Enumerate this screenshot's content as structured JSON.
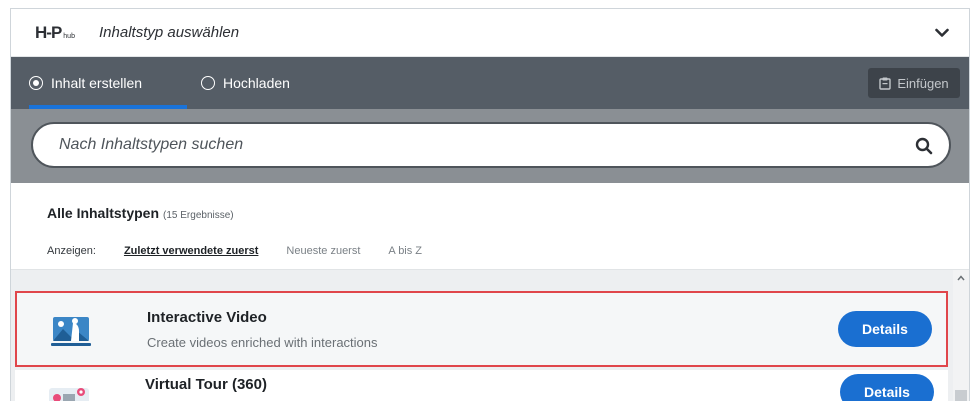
{
  "header": {
    "logo_main": "H-P",
    "logo_sub": "hub",
    "title": "Inhaltstyp auswählen",
    "collapse_icon": "chevron-down-icon"
  },
  "tabs": [
    {
      "label": "Inhalt erstellen",
      "selected": true
    },
    {
      "label": "Hochladen",
      "selected": false
    }
  ],
  "paste_button": {
    "label": "Einfügen",
    "icon": "clipboard-icon"
  },
  "search": {
    "placeholder": "Nach Inhaltstypen suchen",
    "value": "",
    "icon": "search-icon"
  },
  "results": {
    "heading": "Alle Inhaltstypen",
    "count_text": "(15 Ergebnisse)",
    "sort_label": "Anzeigen:",
    "sort_options": [
      {
        "label": "Zuletzt verwendete zuerst",
        "active": true
      },
      {
        "label": "Neueste zuerst",
        "active": false
      },
      {
        "label": "A bis Z",
        "active": false
      }
    ]
  },
  "items": [
    {
      "title": "Interactive Video",
      "description": "Create videos enriched with interactions",
      "button": "Details",
      "icon": "interactive-video-icon"
    },
    {
      "title": "Virtual Tour (360)",
      "description": "",
      "button": "Details",
      "icon": "virtual-tour-icon"
    }
  ],
  "colors": {
    "accent": "#1a6fd1",
    "tabbar": "#555d66",
    "searchbar": "#8a8f94",
    "highlight_border": "#e0464b"
  }
}
